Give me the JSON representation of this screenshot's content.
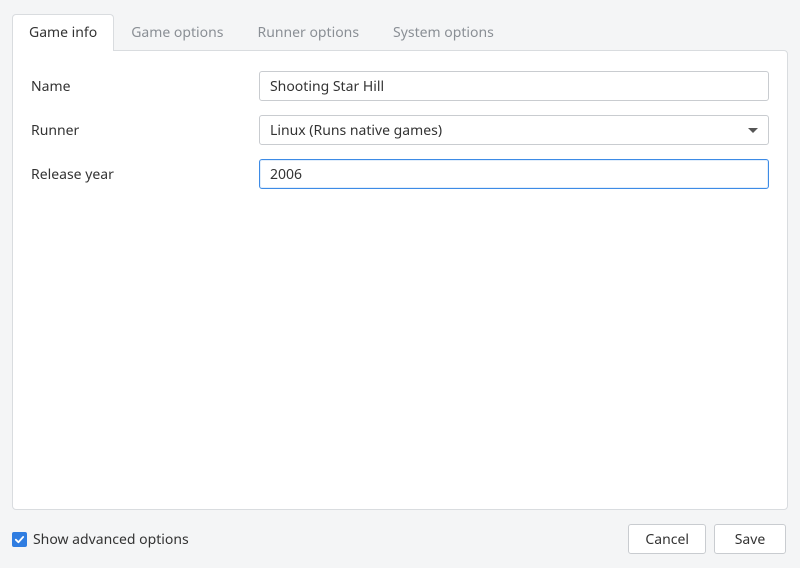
{
  "tabs": {
    "game_info": "Game info",
    "game_options": "Game options",
    "runner_options": "Runner options",
    "system_options": "System options",
    "active": "game_info"
  },
  "form": {
    "name_label": "Name",
    "name_value": "Shooting Star Hill",
    "runner_label": "Runner",
    "runner_value": "Linux (Runs native games)",
    "release_year_label": "Release year",
    "release_year_value": "2006"
  },
  "footer": {
    "show_advanced_label": "Show advanced options",
    "show_advanced_checked": true,
    "cancel_label": "Cancel",
    "save_label": "Save"
  }
}
